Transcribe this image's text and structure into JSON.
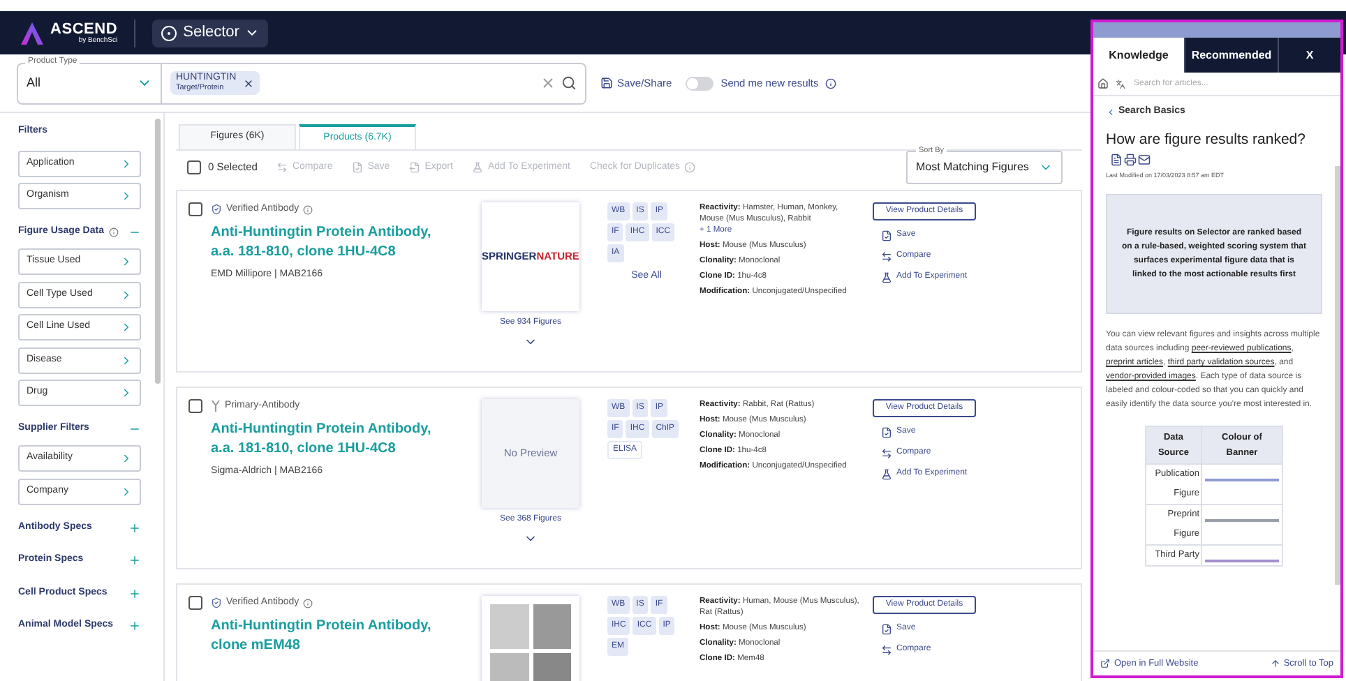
{
  "header": {
    "logo": {
      "name": "ASCEND",
      "tagline": "by BenchSci"
    },
    "app_switcher": "Selector"
  },
  "search": {
    "product_type": {
      "label": "Product Type",
      "value": "All"
    },
    "chip": {
      "title": "HUNTINGTIN",
      "subtitle": "Target/Protein"
    },
    "save_share": "Save/Share",
    "notify": {
      "label": "Send me new results",
      "on": false
    }
  },
  "sidebar": {
    "title": "Filters",
    "filters": [
      "Application",
      "Organism"
    ],
    "groups": [
      {
        "title": "Figure Usage Data",
        "info": true,
        "expanded": true,
        "items": [
          "Tissue Used",
          "Cell Type Used",
          "Cell Line Used",
          "Disease",
          "Drug"
        ]
      },
      {
        "title": "Supplier Filters",
        "info": false,
        "expanded": true,
        "items": [
          "Availability",
          "Company"
        ]
      },
      {
        "title": "Antibody Specs",
        "info": false,
        "expanded": false
      },
      {
        "title": "Protein Specs",
        "info": false,
        "expanded": false
      },
      {
        "title": "Cell Product Specs",
        "info": false,
        "expanded": false
      },
      {
        "title": "Animal Model Specs",
        "info": false,
        "expanded": false
      }
    ]
  },
  "tabs": [
    {
      "label": "Figures (6K)",
      "selected": false
    },
    {
      "label": "Products (6.7K)",
      "selected": true
    }
  ],
  "toolbar": {
    "selection": {
      "label": "0 Selected",
      "checked": false
    },
    "actions": [
      {
        "kind": "compare",
        "label": "Compare",
        "disabled": true
      },
      {
        "kind": "save",
        "label": "Save",
        "disabled": true
      },
      {
        "kind": "export",
        "label": "Export",
        "disabled": true
      },
      {
        "kind": "experiment",
        "label": "Add To Experiment",
        "disabled": true
      },
      {
        "kind": "duplicates",
        "label": "Check for Duplicates",
        "disabled": true
      }
    ],
    "sort": {
      "label": "Sort By",
      "value": "Most Matching Figures"
    }
  },
  "products": [
    {
      "checked": false,
      "kind": "verified",
      "badge": "Verified Antibody",
      "badge_info": true,
      "title": "Anti-Huntingtin Protein Antibody, a.a. 181-810, clone 1HU-4C8",
      "vendor": "EMD Millipore | MAB2166",
      "preview": {
        "kind": "logo",
        "parts": [
          "SPRINGER",
          "NATURE"
        ]
      },
      "figures_link": "See 934 Figures",
      "tags": [
        {
          "label": "WB",
          "filled": true
        },
        {
          "label": "IS",
          "filled": true
        },
        {
          "label": "IP",
          "filled": true
        },
        {
          "label": "IF",
          "filled": true
        },
        {
          "label": "IHC",
          "filled": true
        },
        {
          "label": "ICC",
          "filled": true
        },
        {
          "label": "IA",
          "filled": true
        }
      ],
      "see_all": "See All",
      "specs": [
        {
          "label": "Reactivity:",
          "value": "Hamster, Human, Monkey, Mouse (Mus Musculus), Rabbit",
          "more": "+ 1 More"
        },
        {
          "label": "Host:",
          "value": "Mouse (Mus Musculus)"
        },
        {
          "label": "Clonality:",
          "value": "Monoclonal"
        },
        {
          "label": "Clone ID:",
          "value": "1hu-4c8"
        },
        {
          "label": "Modification:",
          "value": "Unconjugated/Unspecified"
        }
      ],
      "details_button": "View Product Details",
      "actions": [
        {
          "kind": "save",
          "label": "Save"
        },
        {
          "kind": "compare",
          "label": "Compare"
        },
        {
          "kind": "experiment",
          "label": "Add To Experiment"
        }
      ]
    },
    {
      "checked": false,
      "kind": "primary",
      "badge": "Primary-Antibody",
      "badge_info": false,
      "title": "Anti-Huntingtin Protein Antibody, a.a. 181-810, clone 1HU-4C8",
      "vendor": "Sigma-Aldrich | MAB2166",
      "preview": {
        "kind": "blurred",
        "text": "No Preview"
      },
      "figures_link": "See 368 Figures",
      "tags": [
        {
          "label": "WB",
          "filled": true
        },
        {
          "label": "IS",
          "filled": true
        },
        {
          "label": "IP",
          "filled": true
        },
        {
          "label": "IF",
          "filled": true
        },
        {
          "label": "IHC",
          "filled": true
        },
        {
          "label": "ChIP",
          "filled": true
        },
        {
          "label": "ELISA",
          "filled": false
        }
      ],
      "specs": [
        {
          "label": "Reactivity:",
          "value": "Rabbit, Rat (Rattus)"
        },
        {
          "label": "Host:",
          "value": "Mouse (Mus Musculus)"
        },
        {
          "label": "Clonality:",
          "value": "Monoclonal"
        },
        {
          "label": "Clone ID:",
          "value": "1hu-4c8"
        },
        {
          "label": "Modification:",
          "value": "Unconjugated/Unspecified"
        }
      ],
      "details_button": "View Product Details",
      "actions": [
        {
          "kind": "save",
          "label": "Save"
        },
        {
          "kind": "compare",
          "label": "Compare"
        },
        {
          "kind": "experiment",
          "label": "Add To Experiment"
        }
      ]
    },
    {
      "checked": false,
      "kind": "verified",
      "badge": "Verified Antibody",
      "badge_info": true,
      "title": "Anti-Huntingtin Protein Antibody, clone mEM48",
      "preview": {
        "kind": "figure"
      },
      "tags": [
        {
          "label": "WB",
          "filled": true
        },
        {
          "label": "IS",
          "filled": true
        },
        {
          "label": "IF",
          "filled": true
        },
        {
          "label": "IHC",
          "filled": true
        },
        {
          "label": "ICC",
          "filled": true
        },
        {
          "label": "IP",
          "filled": true
        },
        {
          "label": "EM",
          "filled": true
        }
      ],
      "specs": [
        {
          "label": "Reactivity:",
          "value": "Human, Mouse (Mus Musculus), Rat (Rattus)"
        },
        {
          "label": "Host:",
          "value": "Mouse (Mus Musculus)"
        },
        {
          "label": "Clonality:",
          "value": "Monoclonal"
        },
        {
          "label": "Clone ID:",
          "value": "Mem48"
        }
      ],
      "details_button": "View Product Details",
      "actions": [
        {
          "kind": "save",
          "label": "Save"
        },
        {
          "kind": "compare",
          "label": "Compare"
        }
      ]
    }
  ],
  "help_panel": {
    "tabs": [
      {
        "label": "Knowledge",
        "selected": true
      },
      {
        "label": "Recommended",
        "selected": false
      }
    ],
    "close": "X",
    "search_placeholder": "Search for articles...",
    "breadcrumb": "Search Basics",
    "article": {
      "title": "How are figure results ranked?",
      "modified": "Last Modified on 17/03/2023 8:57 am EDT",
      "callout": "Figure results on Selector are ranked based on a rule-based, weighted scoring system that surfaces experimental figure data that is linked to the most actionable results first",
      "paragraph": [
        {
          "kind": "text",
          "text": "You can view relevant figures and insights across multiple data sources including "
        },
        {
          "kind": "link",
          "text": "peer-reviewed publications"
        },
        {
          "kind": "text",
          "text": ", "
        },
        {
          "kind": "link",
          "text": "preprint articles"
        },
        {
          "kind": "text",
          "text": ", "
        },
        {
          "kind": "link",
          "text": "third party validation sources"
        },
        {
          "kind": "text",
          "text": ", and "
        },
        {
          "kind": "link",
          "text": "vendor-provided images"
        },
        {
          "kind": "text",
          "text": ". Each type of data source is labeled and colour-coded so that you can quickly and easily identify the data source you're most interested in."
        }
      ],
      "table": {
        "headers": [
          "Data Source",
          "Colour of Banner"
        ],
        "rows": [
          {
            "source": "Publication Figure",
            "color": "#8e9bd4"
          },
          {
            "source": "Preprint Figure",
            "color": "#9aa0a8"
          },
          {
            "source": "Third Party",
            "color": "#a48fd0"
          }
        ]
      }
    },
    "footer": {
      "open_link": "Open in Full Website",
      "scroll_top": "Scroll to Top"
    }
  }
}
